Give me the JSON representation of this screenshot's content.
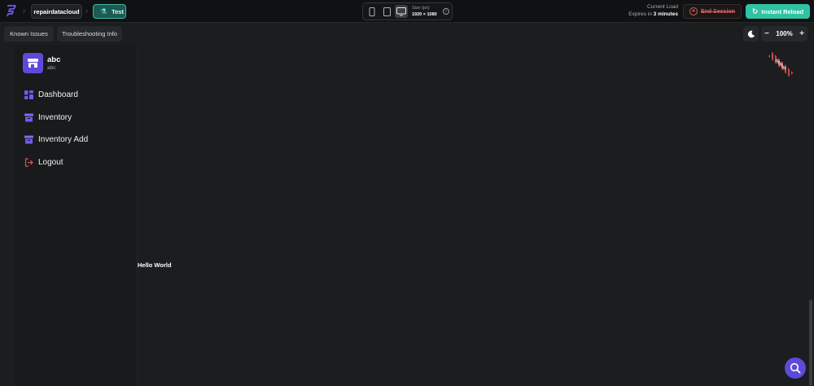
{
  "topbar": {
    "project_name": "repairdatacloud",
    "env_name": "Test",
    "size_label": "Size (px)",
    "size_value": "1920 × 1080",
    "load_label": "Current Load",
    "expires_prefix": "Expires in",
    "expires_value": "3 minutes",
    "end_session_label": "End Session",
    "reload_label": "Instant Reload"
  },
  "toolbar": {
    "known_issues": "Known Issues",
    "troubleshooting": "Troubleshooting Info",
    "zoom_value": "100%"
  },
  "sidebar": {
    "brand_name": "abc",
    "brand_sub": "abc",
    "items": [
      {
        "label": "Dashboard",
        "icon": "dashboard-icon"
      },
      {
        "label": "Inventory",
        "icon": "inventory-icon"
      },
      {
        "label": "Inventory Add",
        "icon": "inventory-add-icon"
      },
      {
        "label": "Logout",
        "icon": "logout-icon"
      }
    ]
  },
  "main": {
    "hello_text": "Hello World",
    "debug_label": "DEBUG"
  },
  "colors": {
    "accent": "#5b4bdb",
    "reload": "#2fc3a4",
    "danger": "#e25c5c",
    "background": "#1b1d1f"
  }
}
